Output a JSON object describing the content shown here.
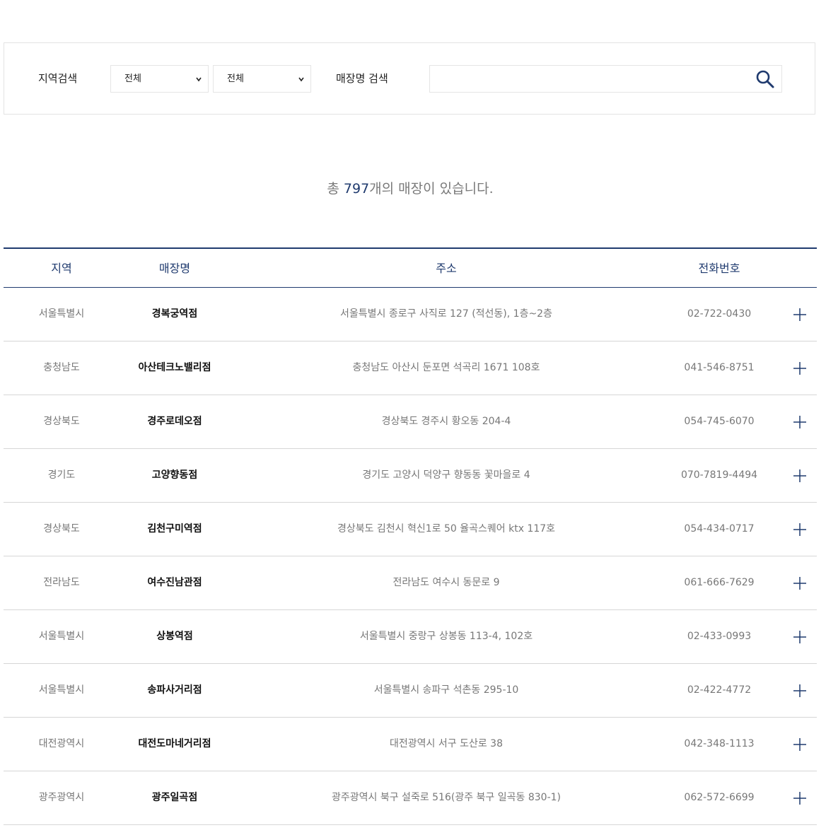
{
  "search": {
    "region_label": "지역검색",
    "region1_selected": "전체",
    "region2_selected": "전체",
    "store_label": "매장명 검색",
    "store_value": ""
  },
  "summary": {
    "prefix": "총 ",
    "count": "797",
    "suffix": "개의 매장이 있습니다."
  },
  "table": {
    "headers": {
      "region": "지역",
      "name": "매장명",
      "address": "주소",
      "phone": "전화번호"
    },
    "rows": [
      {
        "region": "서울특별시",
        "name": "경복궁역점",
        "address": "서울특별시 종로구 사직로 127 (적선동), 1층~2층",
        "phone": "02-722-0430"
      },
      {
        "region": "충청남도",
        "name": "아산테크노밸리점",
        "address": "충청남도 아산시 둔포면 석곡리 1671 108호",
        "phone": "041-546-8751"
      },
      {
        "region": "경상북도",
        "name": "경주로데오점",
        "address": "경상북도 경주시 황오동 204-4",
        "phone": "054-745-6070"
      },
      {
        "region": "경기도",
        "name": "고양향동점",
        "address": "경기도 고양시 덕양구 향동동 꽃마을로 4",
        "phone": "070-7819-4494"
      },
      {
        "region": "경상북도",
        "name": "김천구미역점",
        "address": "경상북도 김천시 혁신1로 50 율곡스퀘어 ktx 117호",
        "phone": "054-434-0717"
      },
      {
        "region": "전라남도",
        "name": "여수진남관점",
        "address": "전라남도 여수시 동문로 9",
        "phone": "061-666-7629"
      },
      {
        "region": "서울특별시",
        "name": "상봉역점",
        "address": "서울특별시 중랑구 상봉동 113-4, 102호",
        "phone": "02-433-0993"
      },
      {
        "region": "서울특별시",
        "name": "송파사거리점",
        "address": "서울특별시 송파구 석촌동 295-10",
        "phone": "02-422-4772"
      },
      {
        "region": "대전광역시",
        "name": "대전도마네거리점",
        "address": "대전광역시 서구 도산로 38",
        "phone": "042-348-1113"
      },
      {
        "region": "광주광역시",
        "name": "광주일곡점",
        "address": "광주광역시 북구 설죽로 516(광주 북구 일곡동 830-1)",
        "phone": "062-572-6699"
      }
    ]
  },
  "icons": {
    "search": "search-icon",
    "expand": "plus-icon",
    "dropdown": "chevron-down-icon"
  },
  "colors": {
    "accent": "#1f3a6e",
    "muted_text": "#777777",
    "border": "#d6d6d6"
  }
}
